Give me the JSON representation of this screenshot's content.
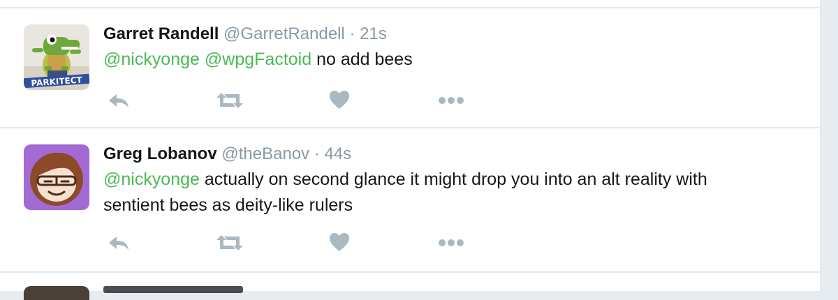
{
  "tweets": [
    {
      "fullname": "Garret Randell",
      "username": "@GarretRandell",
      "separator": "·",
      "time": "21s",
      "mentions": [
        "@nickyonge",
        "@wpgFactoid"
      ],
      "text": "no add bees",
      "avatar": {
        "banner_text": "PARKITECT",
        "icon": "crocodile-mascot-avatar"
      }
    },
    {
      "fullname": "Greg Lobanov",
      "username": "@theBanov",
      "separator": "·",
      "time": "44s",
      "mentions": [
        "@nickyonge"
      ],
      "text_line1": "actually on second glance it might drop you into an alt reality with",
      "text_line2": "sentient bees as deity-like rulers",
      "avatar": {
        "icon": "cartoon-face-avatar"
      }
    }
  ],
  "actions": [
    "reply-icon",
    "retweet-icon",
    "like-icon",
    "more-icon"
  ],
  "colors": {
    "mention": "#4ab954",
    "meta": "#8899a6",
    "action_icon": "#aab8c2",
    "border": "#e1e8ed"
  }
}
